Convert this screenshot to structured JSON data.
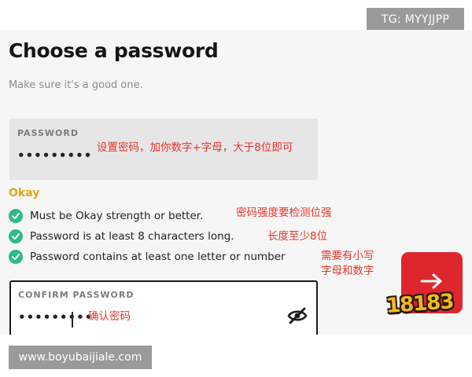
{
  "watermark_top": "TG: MYYJJPP",
  "watermark_bottom": "www.boyubaijiale.com",
  "page": {
    "title": "Choose a password",
    "subtitle": "Make sure it's a good one."
  },
  "password_field": {
    "label": "PASSWORD",
    "value": "•••••••••"
  },
  "strength": {
    "label": "Okay",
    "color": "#d9a91a"
  },
  "requirements": [
    {
      "text": "Must be Okay strength or better.",
      "met": true
    },
    {
      "text": "Password is at least 8 characters long.",
      "met": true
    },
    {
      "text": "Password contains at least one letter or number",
      "met": true
    }
  ],
  "confirm_field": {
    "label": "CONFIRM PASSWORD",
    "value": "•••••••••"
  },
  "annotations": {
    "password_note": "设置密码，加你数字+字母，大于8位即可",
    "strength_note": "密码强度要检测位强",
    "length_note": "长度至少8位",
    "letter_note_line1": "需要有小写",
    "letter_note_line2": "字母和数字",
    "confirm_note": "确认密码"
  },
  "logo_text": "18183",
  "icons": {
    "check": "check-circle-icon",
    "visibility": "eye-off-icon",
    "next": "arrow-right-icon"
  },
  "colors": {
    "accent": "#e0262d",
    "check": "#2fb98f",
    "annotation": "#e8342c"
  }
}
